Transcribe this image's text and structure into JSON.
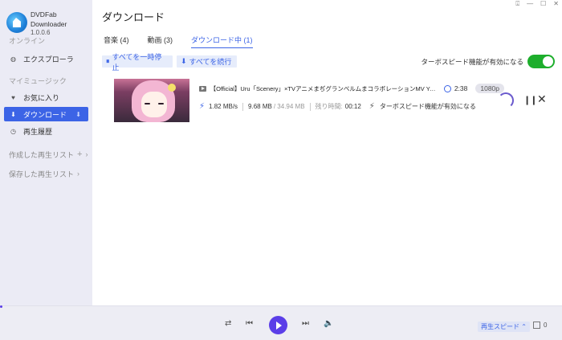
{
  "app": {
    "name": "DVDFab Downloader",
    "version": "1.0.0.6"
  },
  "window": {
    "pin": "⍗",
    "minimize": "—",
    "maximize": "☐",
    "close": "✕"
  },
  "sidebar": {
    "online_section": "オンライン",
    "explorer": "エクスプローラ",
    "my_music_section": "マイミュージック",
    "favorites": "お気に入り",
    "downloads": "ダウンロード",
    "history": "再生履歴",
    "created_playlists": "作成した再生リスト",
    "saved_playlists": "保存した再生リスト"
  },
  "page": {
    "title": "ダウンロード",
    "tabs": [
      "音楽 (4)",
      "動画 (3)",
      "ダウンロード中 (1)"
    ],
    "pause_all": "すべてを一時停止",
    "resume_all": "すべてを続行",
    "turbo_label": "ターボスピード機能が有効になる"
  },
  "download_item": {
    "title": "【Official】Uru「Scenery」×TVアニメまぢグランベルムまコラボレーションMV YouTube ...",
    "duration": "2:38",
    "quality": "1080p",
    "speed": "1.82 MB/s",
    "downloaded": "9.68 MB",
    "total": "/ 34.94 MB",
    "remaining_label": "残り時間:",
    "remaining": "00:12",
    "turbo_status": "ターボスピード機能が有効になる"
  },
  "player": {
    "speed_label": "再生スピード ⌃",
    "queue_count": "0"
  },
  "colors": {
    "accent": "#3c64e6",
    "toggle_on": "#1dae2c",
    "play": "#5b3ee8"
  }
}
